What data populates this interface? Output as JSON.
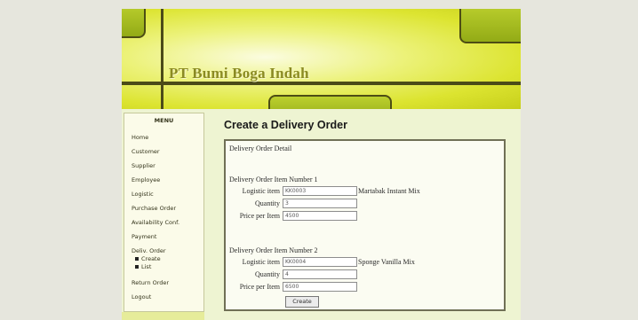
{
  "header": {
    "company_name": "PT Bumi Boga Indah"
  },
  "menu": {
    "title": "MENU",
    "items": {
      "home": "Home",
      "customer": "Customer",
      "supplier": "Supplier",
      "employee": "Employee",
      "logistic": "Logistic",
      "purchase_order": "Purchase Order",
      "availability_conf": "Availability Conf.",
      "payment": "Payment",
      "deliv_order": "Deliv. Order",
      "create": "Create",
      "list": "List",
      "return_order": "Return Order",
      "logout": "Logout"
    }
  },
  "main": {
    "heading": "Create a Delivery Order",
    "detail_title": "Delivery Order Detail",
    "labels": {
      "logistic_item": "Logistic item",
      "quantity": "Quantity",
      "price_per_item": "Price per Item"
    },
    "items": [
      {
        "title": "Delivery Order Item Number 1",
        "logistic_item": "KK0003",
        "item_name": "Martabak Instant Mix",
        "quantity": "3",
        "price": "4500"
      },
      {
        "title": "Delivery Order Item Number 2",
        "logistic_item": "KK0004",
        "item_name": "Sponge Vanilla Mix",
        "quantity": "4",
        "price": "6500"
      }
    ],
    "create_button": "Create"
  }
}
